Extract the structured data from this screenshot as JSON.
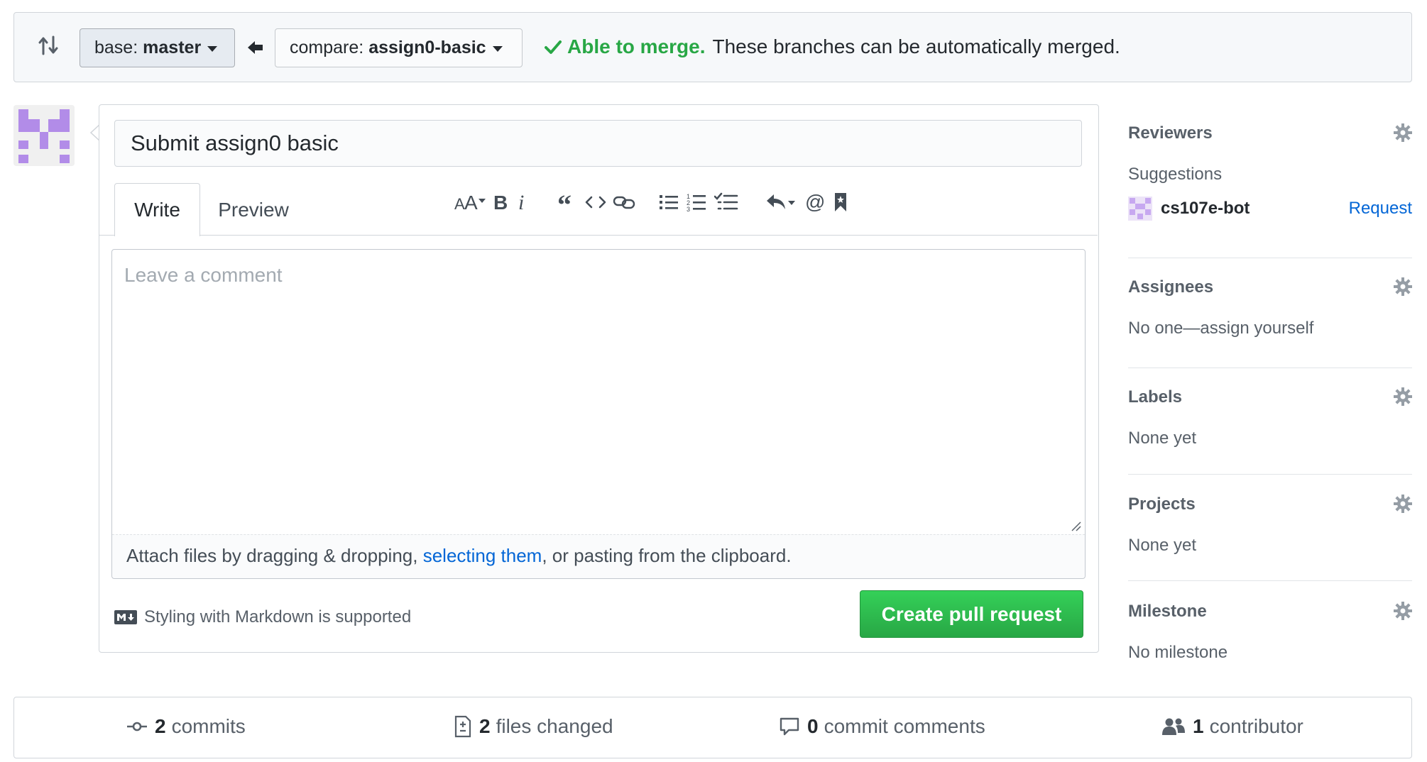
{
  "compare": {
    "base_prefix": "base:",
    "base_branch": "master",
    "compare_prefix": "compare:",
    "compare_branch": "assign0-basic",
    "merge_ok": "Able to merge.",
    "merge_msg": "These branches can be automatically merged."
  },
  "form": {
    "title_value": "Submit assign0 basic",
    "tabs": [
      {
        "label": "Write"
      },
      {
        "label": "Preview"
      }
    ],
    "comment_placeholder": "Leave a comment",
    "attach_before": "Attach files by dragging & dropping, ",
    "attach_link": "selecting them",
    "attach_after": ", or pasting from the clipboard.",
    "markdown_note": "Styling with Markdown is supported",
    "submit_label": "Create pull request",
    "toolbar_icons": [
      "text-size-icon",
      "bold-icon",
      "italic-icon",
      "quote-icon",
      "code-icon",
      "link-icon",
      "unordered-list-icon",
      "ordered-list-icon",
      "task-list-icon",
      "reply-icon",
      "mention-icon",
      "bookmark-icon"
    ]
  },
  "sidebar": {
    "reviewers": {
      "heading": "Reviewers",
      "suggestions_label": "Suggestions",
      "suggested_user": "cs107e-bot",
      "request_label": "Request"
    },
    "assignees": {
      "heading": "Assignees",
      "value": "No one—assign yourself"
    },
    "labels": {
      "heading": "Labels",
      "value": "None yet"
    },
    "projects": {
      "heading": "Projects",
      "value": "None yet"
    },
    "milestone": {
      "heading": "Milestone",
      "value": "No milestone"
    }
  },
  "stats": {
    "commits": {
      "count": "2",
      "label": "commits"
    },
    "files": {
      "count": "2",
      "label": "files changed"
    },
    "comments": {
      "count": "0",
      "label": "commit comments"
    },
    "contributors": {
      "count": "1",
      "label": "contributor"
    }
  },
  "colors": {
    "merge_green": "#28a745",
    "link_blue": "#0366d6",
    "button_green": "#2ea44f",
    "avatar_purple": "#b28ce8"
  }
}
